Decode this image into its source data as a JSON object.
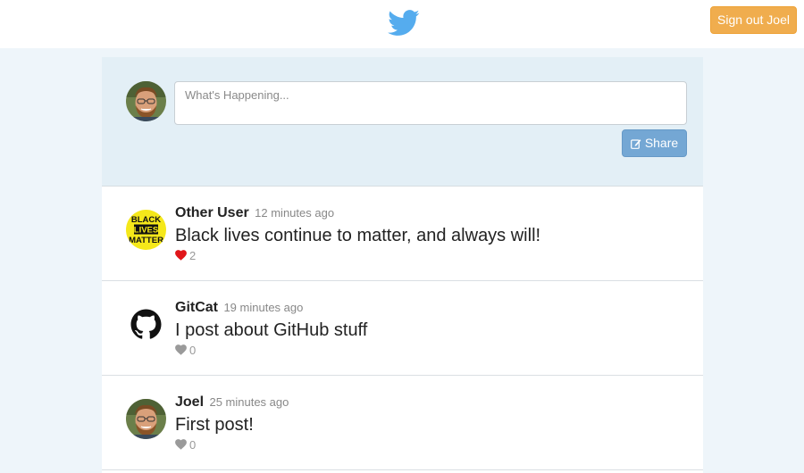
{
  "header": {
    "logo_icon": "twitter-bird-icon",
    "signout_label": "Sign out Joel",
    "signout_color": "#f0ad4e",
    "brand_color": "#55acee"
  },
  "compose": {
    "avatar_icon": "user-avatar",
    "placeholder": "What's Happening...",
    "share_icon": "pencil-square-icon",
    "share_label": "Share"
  },
  "feed": [
    {
      "name": "Other User",
      "time": "12 minutes ago",
      "body": "Black lives continue to matter, and always will!",
      "likes": "2",
      "liked": true,
      "avatar_text": [
        "BLACK",
        "LIVES",
        "MATTER"
      ]
    },
    {
      "name": "GitCat",
      "time": "19 minutes ago",
      "body": "I post about GitHub stuff",
      "likes": "0",
      "liked": false,
      "avatar_icon": "github-octocat-icon"
    },
    {
      "name": "Joel",
      "time": "25 minutes ago",
      "body": "First post!",
      "likes": "0",
      "liked": false,
      "avatar_icon": "user-avatar"
    }
  ],
  "colors": {
    "liked_heart": "#e0161a",
    "unliked_heart": "#9a9a9a"
  }
}
